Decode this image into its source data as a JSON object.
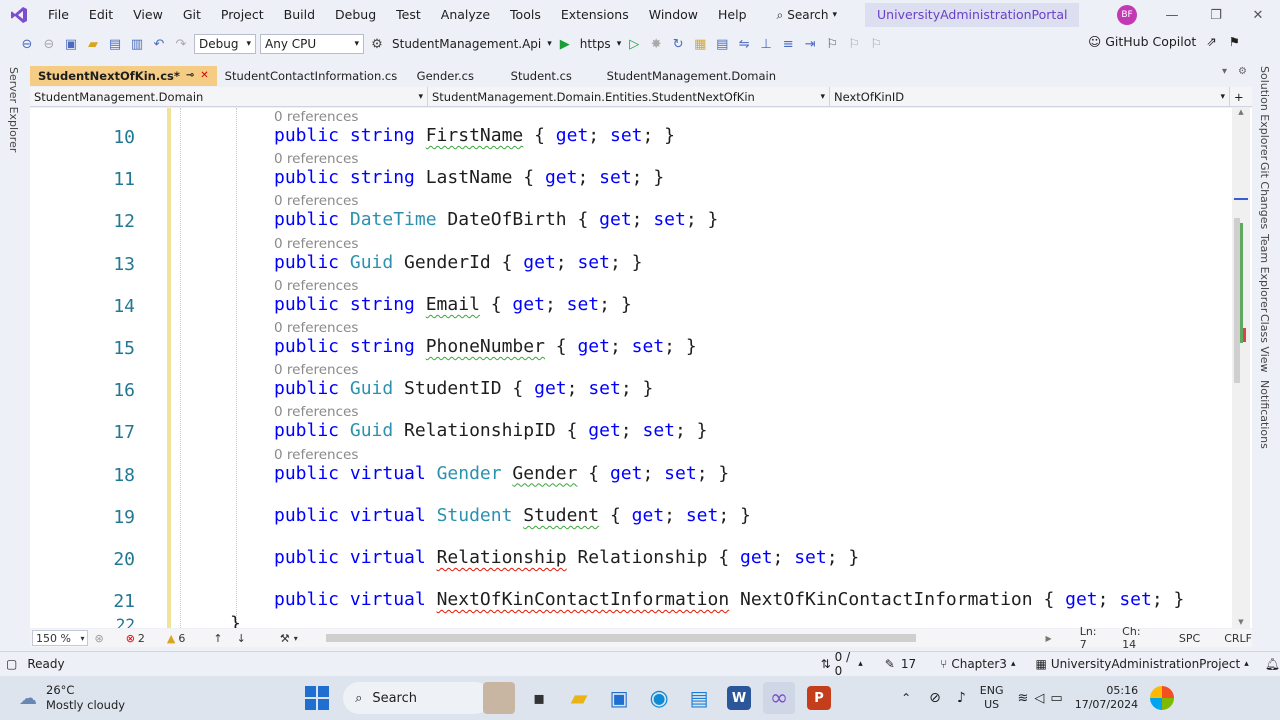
{
  "menu": {
    "items": [
      "File",
      "Edit",
      "View",
      "Git",
      "Project",
      "Build",
      "Debug",
      "Test",
      "Analyze",
      "Tools",
      "Extensions",
      "Window",
      "Help"
    ],
    "search_label": "Search",
    "solution_name": "UniversityAdministrationPortal",
    "avatar_initials": "BF"
  },
  "toolbar": {
    "config": "Debug",
    "platform": "Any CPU",
    "startup_project": "StudentManagement.Api",
    "run_profile": "https",
    "copilot_label": "GitHub Copilot"
  },
  "left_rail": {
    "server_explorer": "Server Explorer"
  },
  "right_rail": {
    "solution_explorer": "Solution Explorer",
    "git_changes": "Git Changes",
    "team_explorer": "Team Explorer",
    "class_view": "Class View",
    "notifications": "Notifications"
  },
  "tabs": [
    {
      "label": "StudentNextOfKin.cs*",
      "active": true
    },
    {
      "label": "StudentContactInformation.cs",
      "active": false
    },
    {
      "label": "Gender.cs",
      "active": false
    },
    {
      "label": "Student.cs",
      "active": false
    },
    {
      "label": "StudentManagement.Domain",
      "active": false
    }
  ],
  "navbar": {
    "project": "StudentManagement.Domain",
    "type": "StudentManagement.Domain.Entities.StudentNextOfKin",
    "member": "NextOfKinID"
  },
  "code": {
    "ref_label": "0 references",
    "lines": [
      {
        "num": "10",
        "ref": true,
        "mod": "public ",
        "type": "string ",
        "type_class": "kw",
        "name": "FirstName",
        "name_sq": "sq",
        "rest": " { get; set; }"
      },
      {
        "num": "11",
        "ref": true,
        "mod": "public ",
        "type": "string ",
        "type_class": "kw",
        "name": "LastName",
        "name_sq": "",
        "rest": " { get; set; }"
      },
      {
        "num": "12",
        "ref": true,
        "mod": "public ",
        "type": "DateTime ",
        "type_class": "ty",
        "name": "DateOfBirth",
        "name_sq": "",
        "rest": " { get; set; }"
      },
      {
        "num": "13",
        "ref": true,
        "mod": "public ",
        "type": "Guid ",
        "type_class": "ty",
        "name": "GenderId",
        "name_sq": "",
        "rest": " { get; set; }"
      },
      {
        "num": "14",
        "ref": true,
        "mod": "public ",
        "type": "string ",
        "type_class": "kw",
        "name": "Email",
        "name_sq": "sq",
        "rest": " { get; set; }"
      },
      {
        "num": "15",
        "ref": true,
        "mod": "public ",
        "type": "string ",
        "type_class": "kw",
        "name": "PhoneNumber",
        "name_sq": "sq",
        "rest": " { get; set; }"
      },
      {
        "num": "16",
        "ref": true,
        "mod": "public ",
        "type": "Guid ",
        "type_class": "ty",
        "name": "StudentID",
        "name_sq": "",
        "rest": " { get; set; }"
      },
      {
        "num": "17",
        "ref": true,
        "mod": "public ",
        "type": "Guid ",
        "type_class": "ty",
        "name": "RelationshipID",
        "name_sq": "",
        "rest": " { get; set; }"
      },
      {
        "num": "18",
        "ref": true,
        "mod": "public virtual ",
        "type": "Gender ",
        "type_class": "ty",
        "name": "Gender",
        "name_sq": "sq",
        "rest": " { get; set; }"
      },
      {
        "num": "19",
        "ref": false,
        "mod": "public virtual ",
        "type": "Student ",
        "type_class": "ty",
        "name": "Student",
        "name_sq": "sq",
        "rest": " { get; set; }"
      },
      {
        "num": "20",
        "ref": false,
        "mod": "public virtual ",
        "type": "Relationship",
        "type_class": "sqr",
        "name": " Relationship",
        "name_sq": "",
        "rest": " { get; set; }"
      },
      {
        "num": "21",
        "ref": false,
        "mod": "public virtual ",
        "type": "NextOfKinContactInformation",
        "type_class": "sqr",
        "name": " NextOfKinContactInformation",
        "name_sq": "",
        "rest": " { get; set; }"
      }
    ],
    "partial_line_num": "22",
    "partial_line_text": "}"
  },
  "editor_status": {
    "zoom": "150 %",
    "errors": "2",
    "warnings": "6",
    "line": "Ln: 7",
    "col": "Ch: 14",
    "spacing": "SPC",
    "eol": "CRLF"
  },
  "statusbar": {
    "ready": "Ready",
    "sync": "0 / 0",
    "edits": "17",
    "branch": "Chapter3",
    "project": "UniversityAdministrationProject"
  },
  "taskbar": {
    "temp": "26°C",
    "weather": "Mostly cloudy",
    "search": "Search",
    "lang1": "ENG",
    "lang2": "US",
    "time": "05:16",
    "date": "17/07/2024"
  },
  "colors": {
    "accent": "#6b3fc8",
    "active_tab": "#f5cc84",
    "keyword": "#0000ff",
    "type": "#2b91af",
    "line_number": "#237893"
  }
}
